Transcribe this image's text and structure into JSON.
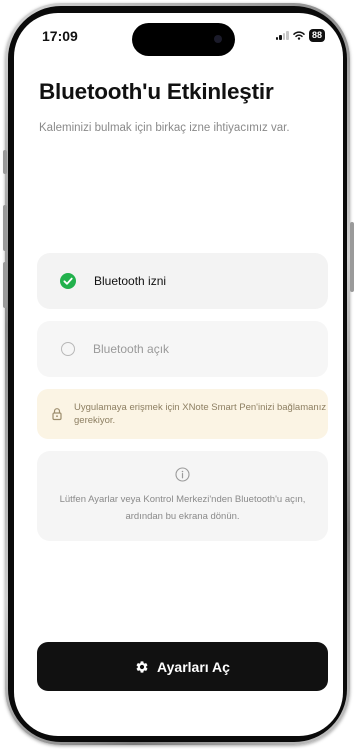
{
  "status_bar": {
    "time": "17:09",
    "battery": "88"
  },
  "header": {
    "title": "Bluetooth'u Etkinleştir",
    "subtitle": "Kaleminizi bulmak için birkaç izne ihtiyacımız var."
  },
  "permissions": [
    {
      "label": "Bluetooth izni",
      "status": "granted",
      "icon": "check-circle-icon"
    },
    {
      "label": "Bluetooth açık",
      "status": "pending",
      "icon": "empty-circle-icon"
    }
  ],
  "notice": {
    "icon": "lock-icon",
    "text": "Uygulamaya erişmek için XNote Smart Pen'inizi bağlamanız gerekiyor."
  },
  "info": {
    "icon": "info-icon",
    "text": "Lütfen Ayarlar veya Kontrol Merkezi'nden Bluetooth'u açın, ardından bu ekrana dönün."
  },
  "cta": {
    "icon": "gear-icon",
    "label": "Ayarları Aç"
  },
  "colors": {
    "accent_green": "#22b14c",
    "notice_bg": "#fbf4e4",
    "button_bg": "#111111"
  }
}
